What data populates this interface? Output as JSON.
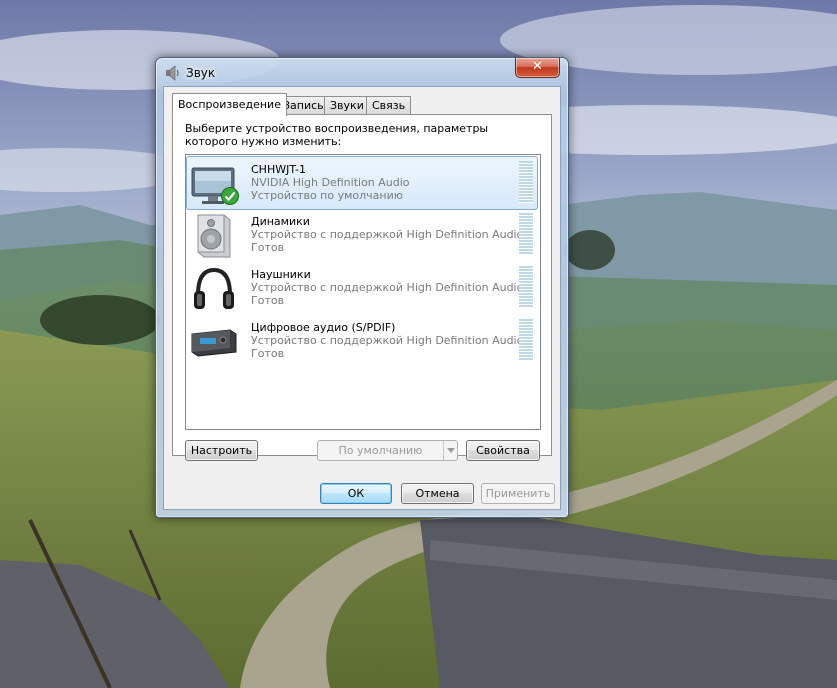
{
  "window": {
    "title": "Звук",
    "close_glyph": "✕"
  },
  "tabs": [
    {
      "label": "Воспроизведение",
      "active": true
    },
    {
      "label": "Запись",
      "active": false
    },
    {
      "label": "Звуки",
      "active": false
    },
    {
      "label": "Связь",
      "active": false
    }
  ],
  "panel": {
    "instruction": "Выберите устройство воспроизведения, параметры которого нужно изменить:"
  },
  "devices": [
    {
      "name": "CHHWJT-1",
      "line2": "NVIDIA High Definition Audio",
      "line3": "Устройство по умолчанию",
      "icon": "monitor-icon",
      "selected": true,
      "default": true
    },
    {
      "name": "Динамики",
      "line2": "Устройство с поддержкой High Definition Audio",
      "line3": "Готов",
      "icon": "speaker-icon",
      "selected": false
    },
    {
      "name": "Наушники",
      "line2": "Устройство с поддержкой High Definition Audio",
      "line3": "Готов",
      "icon": "headphones-icon",
      "selected": false
    },
    {
      "name": "Цифровое аудио (S/PDIF)",
      "line2": "Устройство с поддержкой High Definition Audio",
      "line3": "Готов",
      "icon": "digital-audio-receiver-icon",
      "selected": false
    }
  ],
  "buttons": {
    "configure": "Настроить",
    "set_default": "По умолчанию",
    "properties": "Свойства",
    "ok": "ОК",
    "cancel": "Отмена",
    "apply": "Применить"
  },
  "colors": {
    "selection_border": "#84acdd",
    "close_button": "#c0391f",
    "meter": "#bcd9e8"
  }
}
